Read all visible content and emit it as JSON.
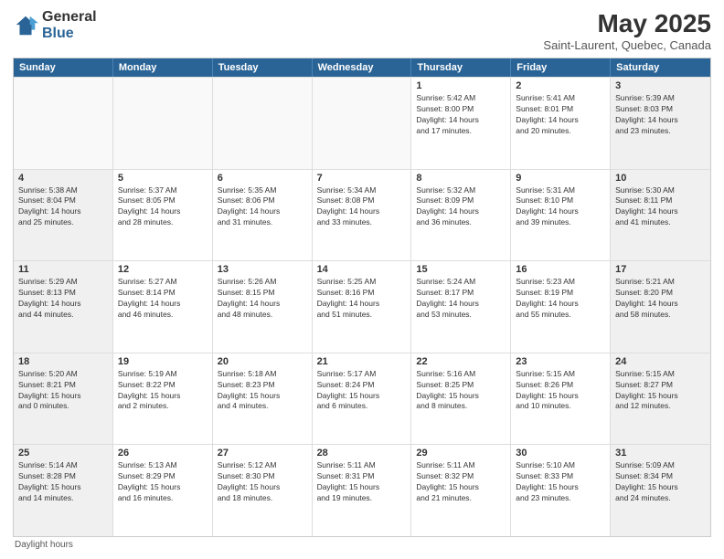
{
  "logo": {
    "general": "General",
    "blue": "Blue"
  },
  "title": "May 2025",
  "subtitle": "Saint-Laurent, Quebec, Canada",
  "days": [
    "Sunday",
    "Monday",
    "Tuesday",
    "Wednesday",
    "Thursday",
    "Friday",
    "Saturday"
  ],
  "footer": "Daylight hours",
  "weeks": [
    [
      {
        "day": "",
        "content": []
      },
      {
        "day": "",
        "content": []
      },
      {
        "day": "",
        "content": []
      },
      {
        "day": "",
        "content": []
      },
      {
        "day": "1",
        "content": [
          "Sunrise: 5:42 AM",
          "Sunset: 8:00 PM",
          "Daylight: 14 hours",
          "and 17 minutes."
        ]
      },
      {
        "day": "2",
        "content": [
          "Sunrise: 5:41 AM",
          "Sunset: 8:01 PM",
          "Daylight: 14 hours",
          "and 20 minutes."
        ]
      },
      {
        "day": "3",
        "content": [
          "Sunrise: 5:39 AM",
          "Sunset: 8:03 PM",
          "Daylight: 14 hours",
          "and 23 minutes."
        ]
      }
    ],
    [
      {
        "day": "4",
        "content": [
          "Sunrise: 5:38 AM",
          "Sunset: 8:04 PM",
          "Daylight: 14 hours",
          "and 25 minutes."
        ]
      },
      {
        "day": "5",
        "content": [
          "Sunrise: 5:37 AM",
          "Sunset: 8:05 PM",
          "Daylight: 14 hours",
          "and 28 minutes."
        ]
      },
      {
        "day": "6",
        "content": [
          "Sunrise: 5:35 AM",
          "Sunset: 8:06 PM",
          "Daylight: 14 hours",
          "and 31 minutes."
        ]
      },
      {
        "day": "7",
        "content": [
          "Sunrise: 5:34 AM",
          "Sunset: 8:08 PM",
          "Daylight: 14 hours",
          "and 33 minutes."
        ]
      },
      {
        "day": "8",
        "content": [
          "Sunrise: 5:32 AM",
          "Sunset: 8:09 PM",
          "Daylight: 14 hours",
          "and 36 minutes."
        ]
      },
      {
        "day": "9",
        "content": [
          "Sunrise: 5:31 AM",
          "Sunset: 8:10 PM",
          "Daylight: 14 hours",
          "and 39 minutes."
        ]
      },
      {
        "day": "10",
        "content": [
          "Sunrise: 5:30 AM",
          "Sunset: 8:11 PM",
          "Daylight: 14 hours",
          "and 41 minutes."
        ]
      }
    ],
    [
      {
        "day": "11",
        "content": [
          "Sunrise: 5:29 AM",
          "Sunset: 8:13 PM",
          "Daylight: 14 hours",
          "and 44 minutes."
        ]
      },
      {
        "day": "12",
        "content": [
          "Sunrise: 5:27 AM",
          "Sunset: 8:14 PM",
          "Daylight: 14 hours",
          "and 46 minutes."
        ]
      },
      {
        "day": "13",
        "content": [
          "Sunrise: 5:26 AM",
          "Sunset: 8:15 PM",
          "Daylight: 14 hours",
          "and 48 minutes."
        ]
      },
      {
        "day": "14",
        "content": [
          "Sunrise: 5:25 AM",
          "Sunset: 8:16 PM",
          "Daylight: 14 hours",
          "and 51 minutes."
        ]
      },
      {
        "day": "15",
        "content": [
          "Sunrise: 5:24 AM",
          "Sunset: 8:17 PM",
          "Daylight: 14 hours",
          "and 53 minutes."
        ]
      },
      {
        "day": "16",
        "content": [
          "Sunrise: 5:23 AM",
          "Sunset: 8:19 PM",
          "Daylight: 14 hours",
          "and 55 minutes."
        ]
      },
      {
        "day": "17",
        "content": [
          "Sunrise: 5:21 AM",
          "Sunset: 8:20 PM",
          "Daylight: 14 hours",
          "and 58 minutes."
        ]
      }
    ],
    [
      {
        "day": "18",
        "content": [
          "Sunrise: 5:20 AM",
          "Sunset: 8:21 PM",
          "Daylight: 15 hours",
          "and 0 minutes."
        ]
      },
      {
        "day": "19",
        "content": [
          "Sunrise: 5:19 AM",
          "Sunset: 8:22 PM",
          "Daylight: 15 hours",
          "and 2 minutes."
        ]
      },
      {
        "day": "20",
        "content": [
          "Sunrise: 5:18 AM",
          "Sunset: 8:23 PM",
          "Daylight: 15 hours",
          "and 4 minutes."
        ]
      },
      {
        "day": "21",
        "content": [
          "Sunrise: 5:17 AM",
          "Sunset: 8:24 PM",
          "Daylight: 15 hours",
          "and 6 minutes."
        ]
      },
      {
        "day": "22",
        "content": [
          "Sunrise: 5:16 AM",
          "Sunset: 8:25 PM",
          "Daylight: 15 hours",
          "and 8 minutes."
        ]
      },
      {
        "day": "23",
        "content": [
          "Sunrise: 5:15 AM",
          "Sunset: 8:26 PM",
          "Daylight: 15 hours",
          "and 10 minutes."
        ]
      },
      {
        "day": "24",
        "content": [
          "Sunrise: 5:15 AM",
          "Sunset: 8:27 PM",
          "Daylight: 15 hours",
          "and 12 minutes."
        ]
      }
    ],
    [
      {
        "day": "25",
        "content": [
          "Sunrise: 5:14 AM",
          "Sunset: 8:28 PM",
          "Daylight: 15 hours",
          "and 14 minutes."
        ]
      },
      {
        "day": "26",
        "content": [
          "Sunrise: 5:13 AM",
          "Sunset: 8:29 PM",
          "Daylight: 15 hours",
          "and 16 minutes."
        ]
      },
      {
        "day": "27",
        "content": [
          "Sunrise: 5:12 AM",
          "Sunset: 8:30 PM",
          "Daylight: 15 hours",
          "and 18 minutes."
        ]
      },
      {
        "day": "28",
        "content": [
          "Sunrise: 5:11 AM",
          "Sunset: 8:31 PM",
          "Daylight: 15 hours",
          "and 19 minutes."
        ]
      },
      {
        "day": "29",
        "content": [
          "Sunrise: 5:11 AM",
          "Sunset: 8:32 PM",
          "Daylight: 15 hours",
          "and 21 minutes."
        ]
      },
      {
        "day": "30",
        "content": [
          "Sunrise: 5:10 AM",
          "Sunset: 8:33 PM",
          "Daylight: 15 hours",
          "and 23 minutes."
        ]
      },
      {
        "day": "31",
        "content": [
          "Sunrise: 5:09 AM",
          "Sunset: 8:34 PM",
          "Daylight: 15 hours",
          "and 24 minutes."
        ]
      }
    ]
  ]
}
